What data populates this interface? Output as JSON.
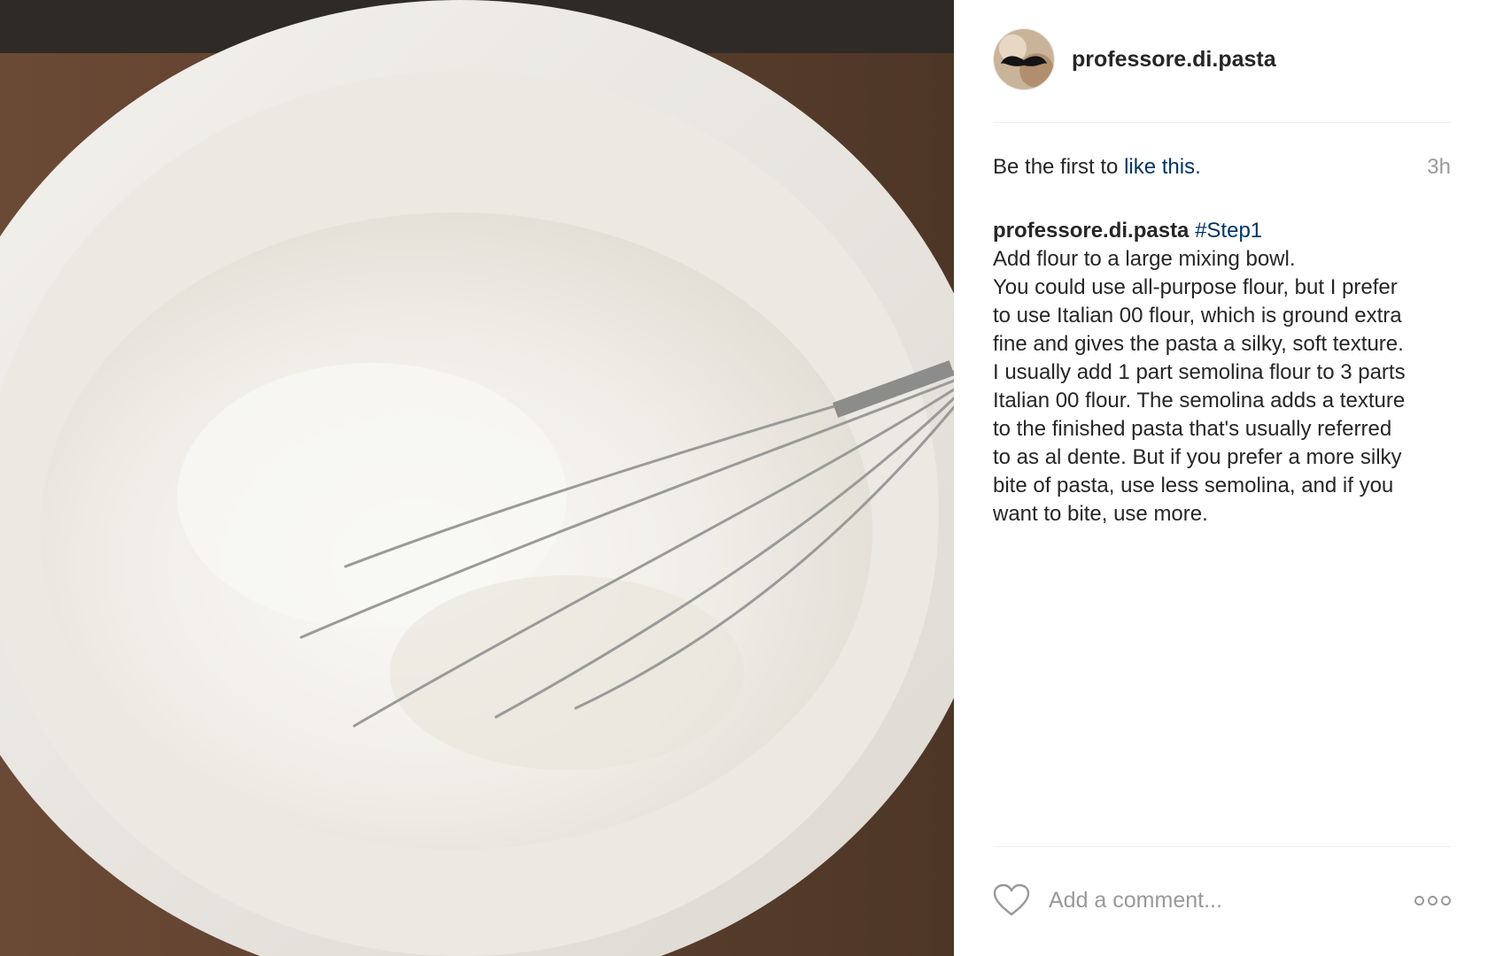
{
  "post": {
    "image_alt": "Flour in a white mixing bowl with a whisk",
    "username": "professore.di.pasta",
    "likes_prefix": "Be the first to",
    "likes_link": "like this.",
    "timestamp": "3h",
    "caption_user": "professore.di.pasta",
    "caption_hashtag": "#Step1",
    "caption_lines": [
      "Add flour to a large mixing bowl.",
      "You could use all-purpose flour, but I prefer",
      "to use Italian 00 flour, which is ground extra",
      "fine and gives the pasta a silky, soft texture.",
      "I usually add 1 part semolina flour to 3 parts",
      "Italian 00 flour. The semolina adds a texture",
      "to the finished pasta that's usually referred",
      "to as al dente. But if you prefer a more silky",
      "bite of pasta, use less semolina, and if you",
      "want to bite, use more."
    ],
    "comment_placeholder": "Add a comment...",
    "icons": {
      "like": "heart-icon",
      "more": "more-options-icon",
      "avatar": "mustache-avatar"
    },
    "colors": {
      "link": "#003569",
      "muted": "#999999",
      "text": "#262626"
    }
  }
}
